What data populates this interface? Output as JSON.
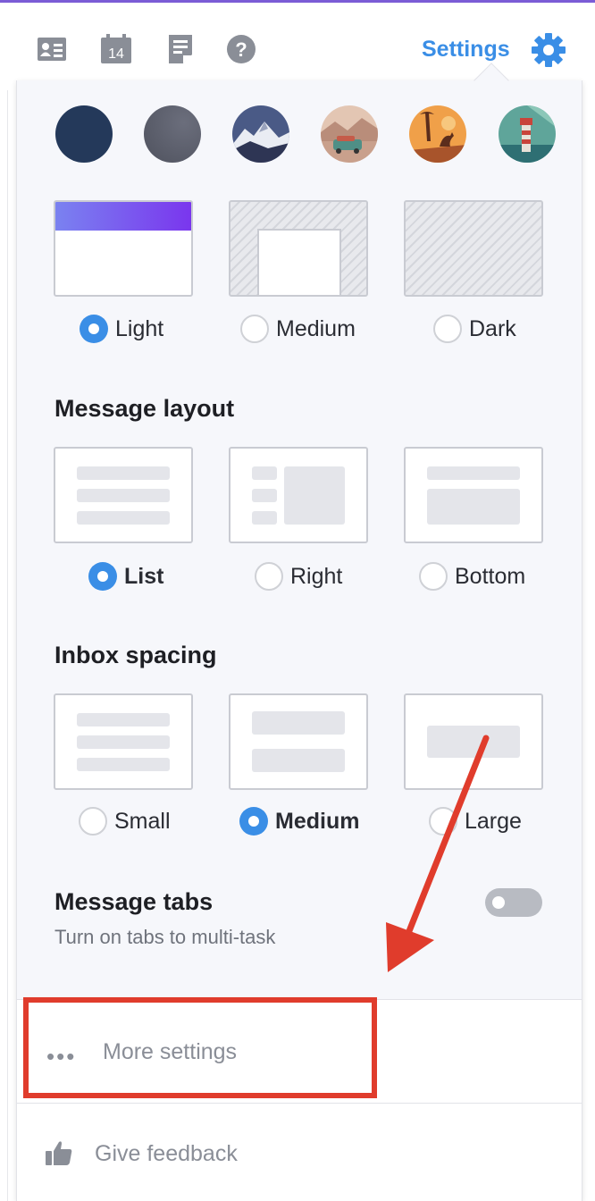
{
  "toolbar": {
    "icons": [
      "contacts-icon",
      "calendar-icon",
      "notepad-icon",
      "help-icon"
    ],
    "calendar_date": "14",
    "settings_label": "Settings"
  },
  "themes": {
    "swatches": [
      "navy-swatch",
      "slate-swatch",
      "mountain-photo",
      "road-trip-photo",
      "kangaroo-photo",
      "lighthouse-photo"
    ],
    "colors": {
      "navy": "#24395a",
      "slate": "#5d606d",
      "accent": "#3a8ee6",
      "purple": "#7a5cf0"
    }
  },
  "appearance": {
    "options": [
      {
        "label": "Light",
        "selected": true
      },
      {
        "label": "Medium",
        "selected": false
      },
      {
        "label": "Dark",
        "selected": false
      }
    ]
  },
  "message_layout": {
    "title": "Message layout",
    "options": [
      {
        "label": "List",
        "selected": true
      },
      {
        "label": "Right",
        "selected": false
      },
      {
        "label": "Bottom",
        "selected": false
      }
    ]
  },
  "inbox_spacing": {
    "title": "Inbox spacing",
    "options": [
      {
        "label": "Small",
        "selected": false
      },
      {
        "label": "Medium",
        "selected": true
      },
      {
        "label": "Large",
        "selected": false
      }
    ]
  },
  "message_tabs": {
    "title": "Message tabs",
    "subtitle": "Turn on tabs to multi-task",
    "enabled": false
  },
  "footer": {
    "more_settings_label": "More settings",
    "feedback_label": "Give feedback"
  },
  "annotation": {
    "color": "#e03c2c"
  }
}
